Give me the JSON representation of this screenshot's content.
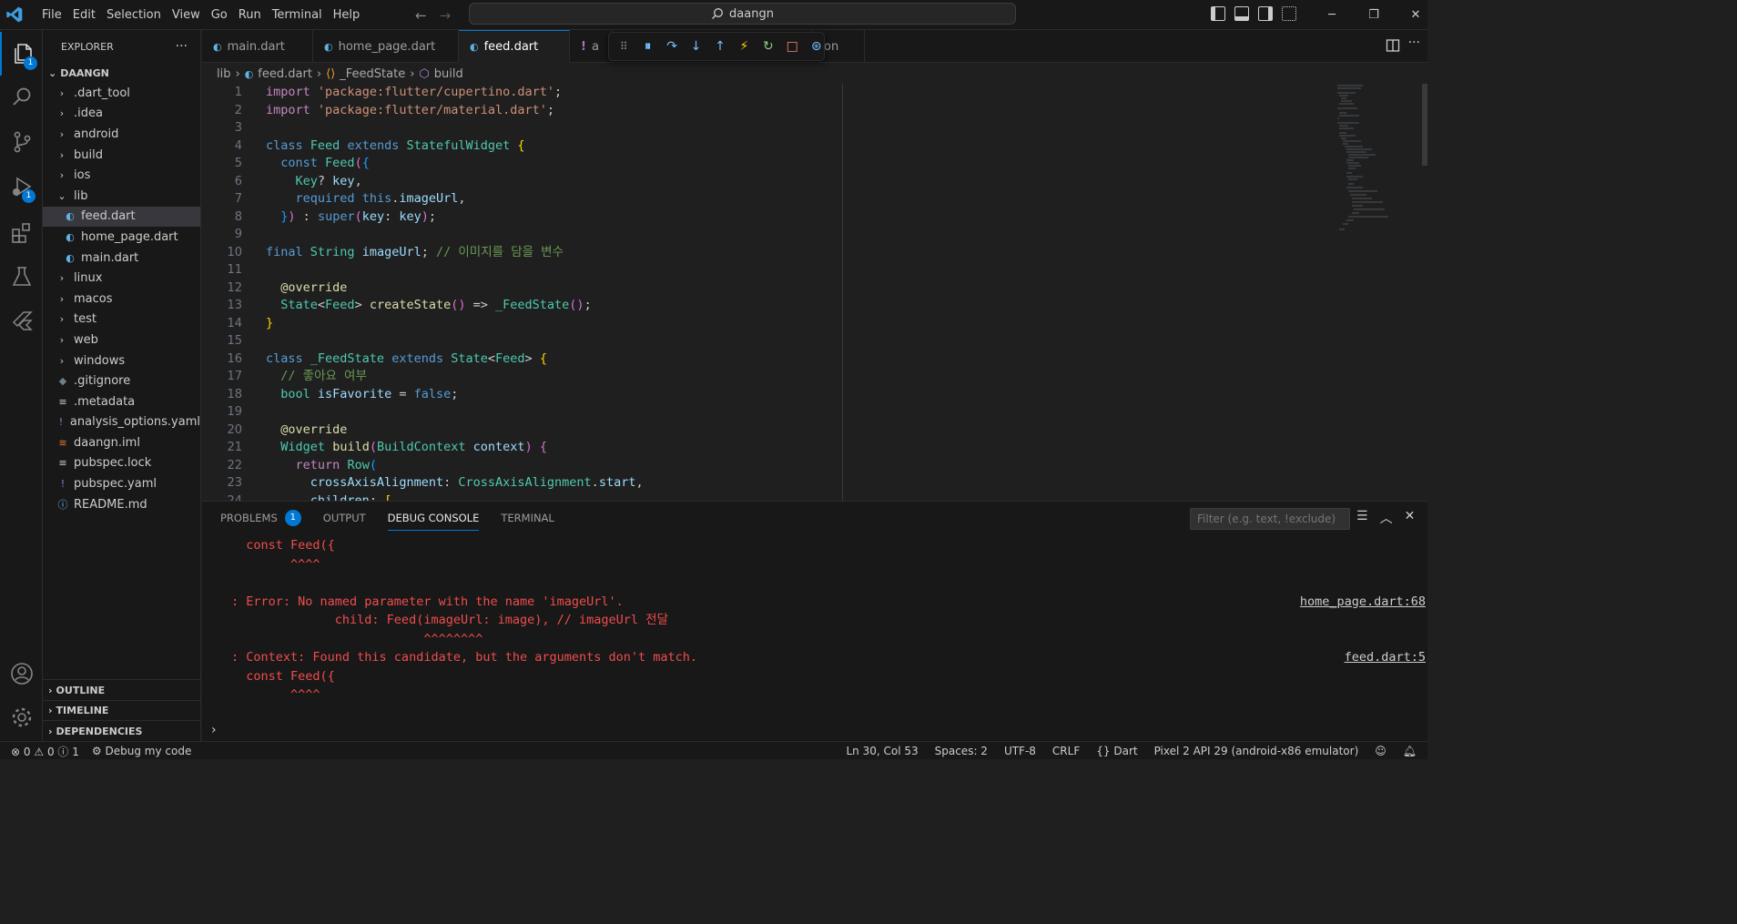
{
  "titlebar": {
    "menu": [
      "File",
      "Edit",
      "Selection",
      "View",
      "Go",
      "Run",
      "Terminal",
      "Help"
    ],
    "search": "daangn",
    "icons": [
      "toggle-sidebar-icon",
      "toggle-panel-icon",
      "toggle-secondary-sidebar-icon",
      "customize-layout-icon"
    ]
  },
  "activity": {
    "explorer_badge": "1",
    "debug_badge": "1"
  },
  "sidebar": {
    "title": "EXPLORER",
    "more": "···",
    "root": "DAANGN",
    "items": [
      {
        "label": ".dart_tool",
        "kind": "folder"
      },
      {
        "label": ".idea",
        "kind": "folder"
      },
      {
        "label": "android",
        "kind": "folder"
      },
      {
        "label": "build",
        "kind": "folder"
      },
      {
        "label": "ios",
        "kind": "folder"
      },
      {
        "label": "lib",
        "kind": "folder-open"
      },
      {
        "label": "feed.dart",
        "kind": "dart",
        "selected": true
      },
      {
        "label": "home_page.dart",
        "kind": "dart"
      },
      {
        "label": "main.dart",
        "kind": "dart"
      },
      {
        "label": "linux",
        "kind": "folder"
      },
      {
        "label": "macos",
        "kind": "folder"
      },
      {
        "label": "test",
        "kind": "folder"
      },
      {
        "label": "web",
        "kind": "folder"
      },
      {
        "label": "windows",
        "kind": "folder"
      },
      {
        "label": ".gitignore",
        "kind": "git"
      },
      {
        "label": ".metadata",
        "kind": "meta"
      },
      {
        "label": "analysis_options.yaml",
        "kind": "yaml"
      },
      {
        "label": "daangn.iml",
        "kind": "iml"
      },
      {
        "label": "pubspec.lock",
        "kind": "meta"
      },
      {
        "label": "pubspec.yaml",
        "kind": "yaml"
      },
      {
        "label": "README.md",
        "kind": "info"
      }
    ],
    "panels": [
      "OUTLINE",
      "TIMELINE",
      "DEPENDENCIES"
    ]
  },
  "tabs": [
    {
      "label": "main.dart"
    },
    {
      "label": "home_page.dart"
    },
    {
      "label": "feed.dart",
      "active": true,
      "modified": true
    },
    {
      "label": "a",
      "partial": true
    },
    {
      "label": "on",
      "partial": true
    }
  ],
  "breadcrumb": [
    "lib",
    "feed.dart",
    "_FeedState",
    "build"
  ],
  "editor": {
    "line_numbers": [
      "1",
      "2",
      "3",
      "4",
      "5",
      "6",
      "7",
      "8",
      "9",
      "10",
      "11",
      "12",
      "13",
      "14",
      "15",
      "16",
      "17",
      "18",
      "19",
      "20",
      "21",
      "22",
      "23",
      "24"
    ]
  },
  "panel": {
    "tabs": [
      "PROBLEMS",
      "OUTPUT",
      "DEBUG CONSOLE",
      "TERMINAL"
    ],
    "problems_count": "1",
    "filter_placeholder": "Filter (e.g. text, !exclude)",
    "console": [
      {
        "text": "  const Feed({",
        "link": ""
      },
      {
        "text": "        ^^^^",
        "link": ""
      },
      {
        "text": "",
        "link": ""
      },
      {
        "text": ": Error: No named parameter with the name 'imageUrl'.",
        "link": "home_page.dart:68"
      },
      {
        "text": "              child: Feed(imageUrl: image), // imageUrl 전달",
        "link": ""
      },
      {
        "text": "                          ^^^^^^^^",
        "link": ""
      },
      {
        "text": ": Context: Found this candidate, but the arguments don't match.",
        "link": "feed.dart:5"
      },
      {
        "text": "  const Feed({",
        "link": ""
      },
      {
        "text": "        ^^^^",
        "link": ""
      }
    ],
    "prompt": "›"
  },
  "status": {
    "errors": "0",
    "warnings": "0",
    "info": "1",
    "debug": "Debug my code",
    "position": "Ln 30, Col 53",
    "spaces": "Spaces: 2",
    "encoding": "UTF-8",
    "eol": "CRLF",
    "language": "Dart",
    "device": "Pixel 2 API 29 (android-x86 emulator)"
  },
  "colors": {
    "accent": "#0078d4",
    "error": "#f14c4c",
    "editor_bg": "#1f1f1f",
    "chrome_bg": "#181818"
  }
}
